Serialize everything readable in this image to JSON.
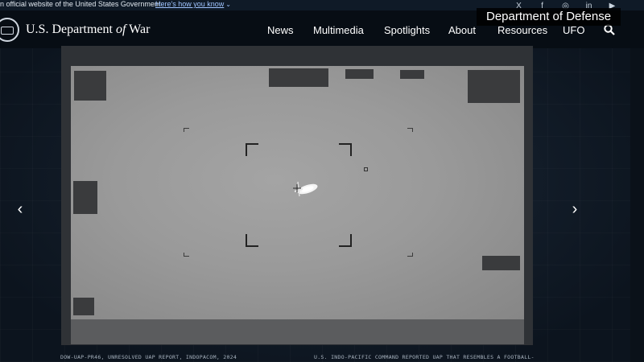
{
  "gov_banner": {
    "official_text": "n official website of the United States Government",
    "how_link": "Here's how you know",
    "how_chevron": "⌄"
  },
  "social": {
    "icons": [
      "x-icon",
      "facebook-icon",
      "instagram-icon",
      "linkedin-icon",
      "youtube-icon"
    ],
    "glyphs": [
      "X",
      "f",
      "◎",
      "in",
      "▶"
    ]
  },
  "header": {
    "title_pre": "U.S. Department ",
    "title_of": "of",
    "title_post": " War",
    "nav": [
      "News",
      "Multimedia",
      "Spotlights",
      "About",
      "Resources",
      "UFO"
    ]
  },
  "overlay_tag": "Department of Defense",
  "carousel": {
    "prev_glyph": "‹",
    "next_glyph": "›"
  },
  "captions": {
    "left": "DOW-UAP-PR46, UNRESOLVED UAP REPORT, INDOPACOM, 2024",
    "right": "U.S. INDO-PACIFIC COMMAND REPORTED UAP THAT RESEMBLES A FOOTBALL-"
  },
  "colors": {
    "header_bg": "#070d14",
    "feed_gray": "#9a9a9a",
    "link_blue": "#9fc4ff"
  }
}
